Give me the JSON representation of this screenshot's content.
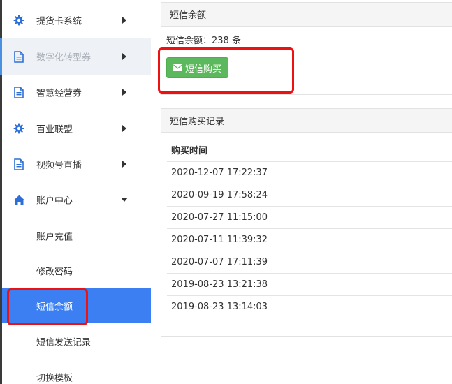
{
  "sidebar": {
    "items": [
      {
        "label": "提货卡系统",
        "icon": "gear-icon"
      },
      {
        "label": "数字化转型券",
        "icon": "document-icon"
      },
      {
        "label": "智慧经营券",
        "icon": "document-icon"
      },
      {
        "label": "百业联盟",
        "icon": "gear-icon"
      },
      {
        "label": "视频号直播",
        "icon": "document-icon"
      },
      {
        "label": "账户中心",
        "icon": "home-icon"
      }
    ],
    "sub_items": [
      {
        "label": "账户充值"
      },
      {
        "label": "修改密码"
      },
      {
        "label": "短信余额"
      },
      {
        "label": "短信发送记录"
      },
      {
        "label": "切换模板"
      }
    ]
  },
  "balance_panel": {
    "title": "短信余额",
    "balance_text": "短信余额：238 条",
    "buy_label": "短信购买",
    "buy_icon": "envelope-icon"
  },
  "records_panel": {
    "title": "短信购买记录",
    "column_header": "购买时间",
    "rows": [
      "2020-12-07 17:22:37",
      "2020-09-19 17:58:24",
      "2020-07-27 11:15:00",
      "2020-07-11 11:39:32",
      "2020-07-07 17:11:39",
      "2019-08-23 13:21:38",
      "2019-08-23 13:14:03"
    ]
  },
  "colors": {
    "selected": "#3b7ff2",
    "button": "#5cb85c",
    "icon": "#2d6fd6",
    "highlight": "#ee1111"
  }
}
